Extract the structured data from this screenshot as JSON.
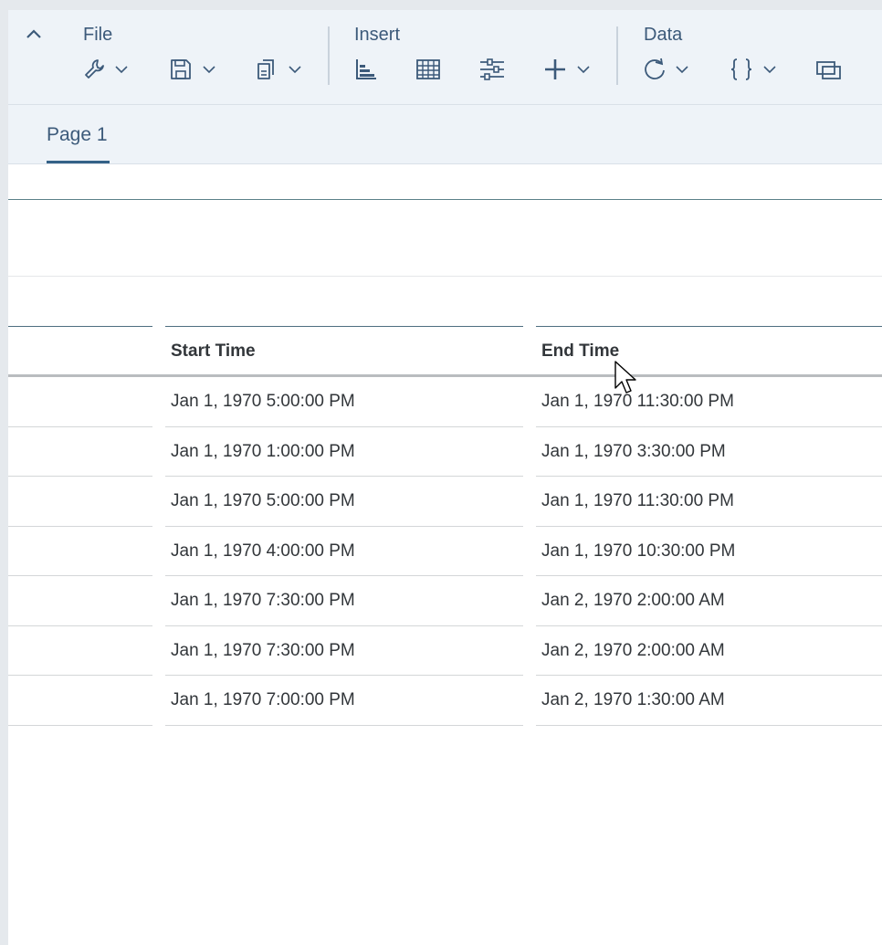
{
  "toolbar": {
    "groups": {
      "file": "File",
      "insert": "Insert",
      "data": "Data"
    },
    "icons": {
      "collapse": "chevron-up-icon",
      "file_buttons": [
        "wrench-icon",
        "save-icon",
        "copy-icon"
      ],
      "insert_buttons": [
        "chart-icon",
        "table-icon",
        "input-control-icon",
        "add-icon"
      ],
      "data_buttons": [
        "refresh-icon",
        "formula-icon",
        "overlay-icon"
      ]
    },
    "accent_color": "#346187"
  },
  "tabs": [
    {
      "label": "Page 1",
      "active": true
    }
  ],
  "table": {
    "columns": [
      "",
      "Start Time",
      "End Time"
    ],
    "rows": [
      [
        "",
        "Jan 1, 1970 5:00:00 PM",
        "Jan 1, 1970 11:30:00 PM"
      ],
      [
        "",
        "Jan 1, 1970 1:00:00 PM",
        "Jan 1, 1970 3:30:00 PM"
      ],
      [
        "",
        "Jan 1, 1970 5:00:00 PM",
        "Jan 1, 1970 11:30:00 PM"
      ],
      [
        "",
        "Jan 1, 1970 4:00:00 PM",
        "Jan 1, 1970 10:30:00 PM"
      ],
      [
        "",
        "Jan 1, 1970 7:30:00 PM",
        "Jan 2, 1970 2:00:00 AM"
      ],
      [
        "",
        "Jan 1, 1970 7:30:00 PM",
        "Jan 2, 1970 2:00:00 AM"
      ],
      [
        "",
        "Jan 1, 1970 7:00:00 PM",
        "Jan 2, 1970 1:30:00 AM"
      ]
    ]
  }
}
